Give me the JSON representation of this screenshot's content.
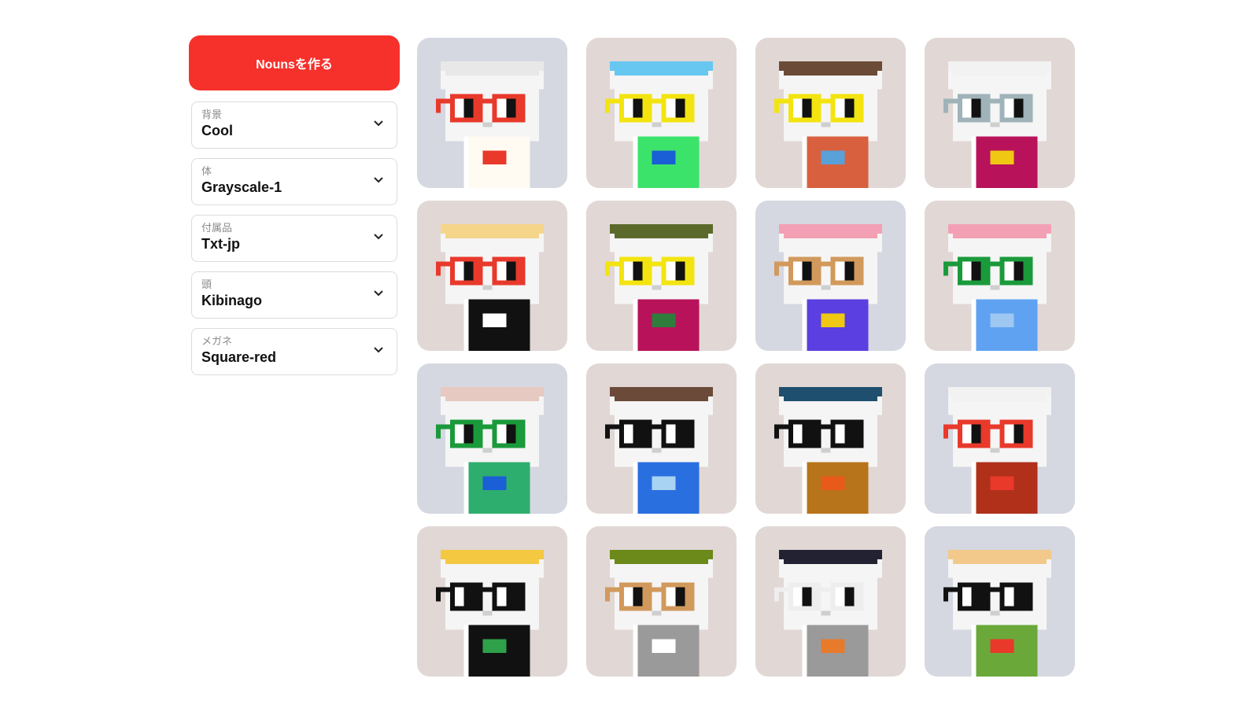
{
  "sidebar": {
    "create_button": "Nounsを作る",
    "selects": [
      {
        "label": "背景",
        "value": "Cool"
      },
      {
        "label": "体",
        "value": "Grayscale-1"
      },
      {
        "label": "付属品",
        "value": "Txt-jp"
      },
      {
        "label": "頭",
        "value": "Kibinago"
      },
      {
        "label": "メガネ",
        "value": "Square-red"
      }
    ]
  },
  "colors": {
    "accent": "#f6302b",
    "cool_bg": "#d5d7e1",
    "warm_bg": "#e1d7d5"
  },
  "nouns": [
    {
      "bg": "cool",
      "head": "#e8e8e8",
      "glasses": "#e8392b",
      "body": "#fffbf2",
      "acc": "#e8392b"
    },
    {
      "bg": "warm",
      "head": "#68c7f0",
      "glasses": "#f3e410",
      "body": "#3ce36b",
      "acc": "#1a5fd6"
    },
    {
      "bg": "warm",
      "head": "#6b4b38",
      "glasses": "#f3e410",
      "body": "#d8603f",
      "acc": "#5aa0d8"
    },
    {
      "bg": "warm",
      "head": "#f2f2f2",
      "glasses": "#9fb3b8",
      "body": "#b8125a",
      "acc": "#f0c814"
    },
    {
      "bg": "warm",
      "head": "#f5d58a",
      "glasses": "#e8392b",
      "body": "#111111",
      "acc": "#ffffff"
    },
    {
      "bg": "warm",
      "head": "#5b6a2a",
      "glasses": "#f3e410",
      "body": "#b8125a",
      "acc": "#2f7d3c"
    },
    {
      "bg": "cool",
      "head": "#f4a0b4",
      "glasses": "#d2995c",
      "body": "#5b3fe0",
      "acc": "#f0c814"
    },
    {
      "bg": "warm",
      "head": "#f4a0b4",
      "glasses": "#1a9a3a",
      "body": "#5fa2f2",
      "acc": "#9ec7f2"
    },
    {
      "bg": "cool",
      "head": "#e6c9c0",
      "glasses": "#1a9a3a",
      "body": "#2eae6e",
      "acc": "#1a5fd6"
    },
    {
      "bg": "warm",
      "head": "#6b4a3a",
      "glasses": "#111111",
      "body": "#2a6fe0",
      "acc": "#a9d3f2"
    },
    {
      "bg": "warm",
      "head": "#1f4f6e",
      "glasses": "#111111",
      "body": "#b8741a",
      "acc": "#e85a1a"
    },
    {
      "bg": "cool",
      "head": "#f2f2f2",
      "glasses": "#e8392b",
      "body": "#b0301a",
      "acc": "#e8392b"
    },
    {
      "bg": "warm",
      "head": "#f5c842",
      "glasses": "#111111",
      "body": "#111111",
      "acc": "#2ea14a"
    },
    {
      "bg": "warm",
      "head": "#6b8a1a",
      "glasses": "#d2995c",
      "body": "#9a9a9a",
      "acc": "#ffffff"
    },
    {
      "bg": "warm",
      "head": "#222233",
      "glasses": "#eeeeee",
      "body": "#9a9a9a",
      "acc": "#e87a2b"
    },
    {
      "bg": "cool",
      "head": "#f2c98a",
      "glasses": "#111111",
      "body": "#6aa83a",
      "acc": "#e8392b"
    }
  ]
}
